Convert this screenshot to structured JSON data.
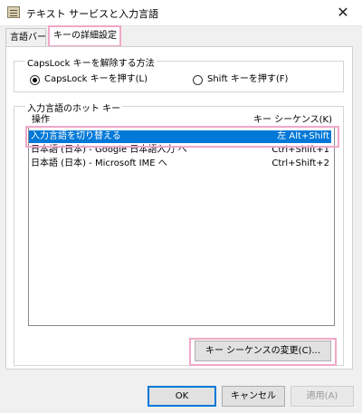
{
  "window": {
    "title": "テキスト サービスと入力言語",
    "icon": "keyboard-settings-icon",
    "close_glyph": "✕"
  },
  "tabs": [
    {
      "label": "言語バー",
      "selected": false
    },
    {
      "label": "キーの詳細設定",
      "selected": true
    }
  ],
  "capslock_group": {
    "legend": "CapsLock キーを解除する方法",
    "options": [
      {
        "label": "CapsLock キーを押す(L)",
        "checked": true
      },
      {
        "label": "Shift キーを押す(F)",
        "checked": false
      }
    ]
  },
  "hotkey_group": {
    "legend": "入力言語のホット キー",
    "columns": {
      "action": "操作",
      "key_sequence": "キー シーケンス(K)"
    },
    "rows": [
      {
        "action": "入力言語を切り替える",
        "keys": "左 Alt+Shift",
        "selected": true
      },
      {
        "action": "日本語 (日本) - Google 日本語入力 へ",
        "keys": "Ctrl+Shift+1",
        "selected": false
      },
      {
        "action": "日本語 (日本) - Microsoft IME へ",
        "keys": "Ctrl+Shift+2",
        "selected": false
      }
    ],
    "change_button": "キー シーケンスの変更(C)..."
  },
  "footer": {
    "ok": "OK",
    "cancel": "キャンセル",
    "apply": "適用(A)"
  },
  "colors": {
    "selection": "#0078d7",
    "annotation_highlight": "#f0a8c8"
  }
}
